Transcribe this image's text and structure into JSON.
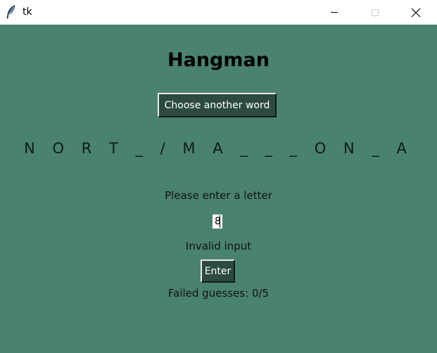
{
  "window": {
    "title": "tk",
    "icons": {
      "app": "feather-icon",
      "minimize": "minimize-icon",
      "maximize": "maximize-icon",
      "close": "close-icon"
    }
  },
  "game": {
    "title": "Hangman",
    "choose_button_label": "Choose another word",
    "word_display": "N O R T _ / M A _ _ _ O N _ A",
    "prompt": "Please enter a letter",
    "input_value": "8",
    "status_message": "Invalid input",
    "enter_button_label": "Enter",
    "failed_guesses": "Failed guesses: 0/5"
  },
  "colors": {
    "background": "#4a8270",
    "button": "#2c4a40",
    "button_text": "#ffffff"
  }
}
